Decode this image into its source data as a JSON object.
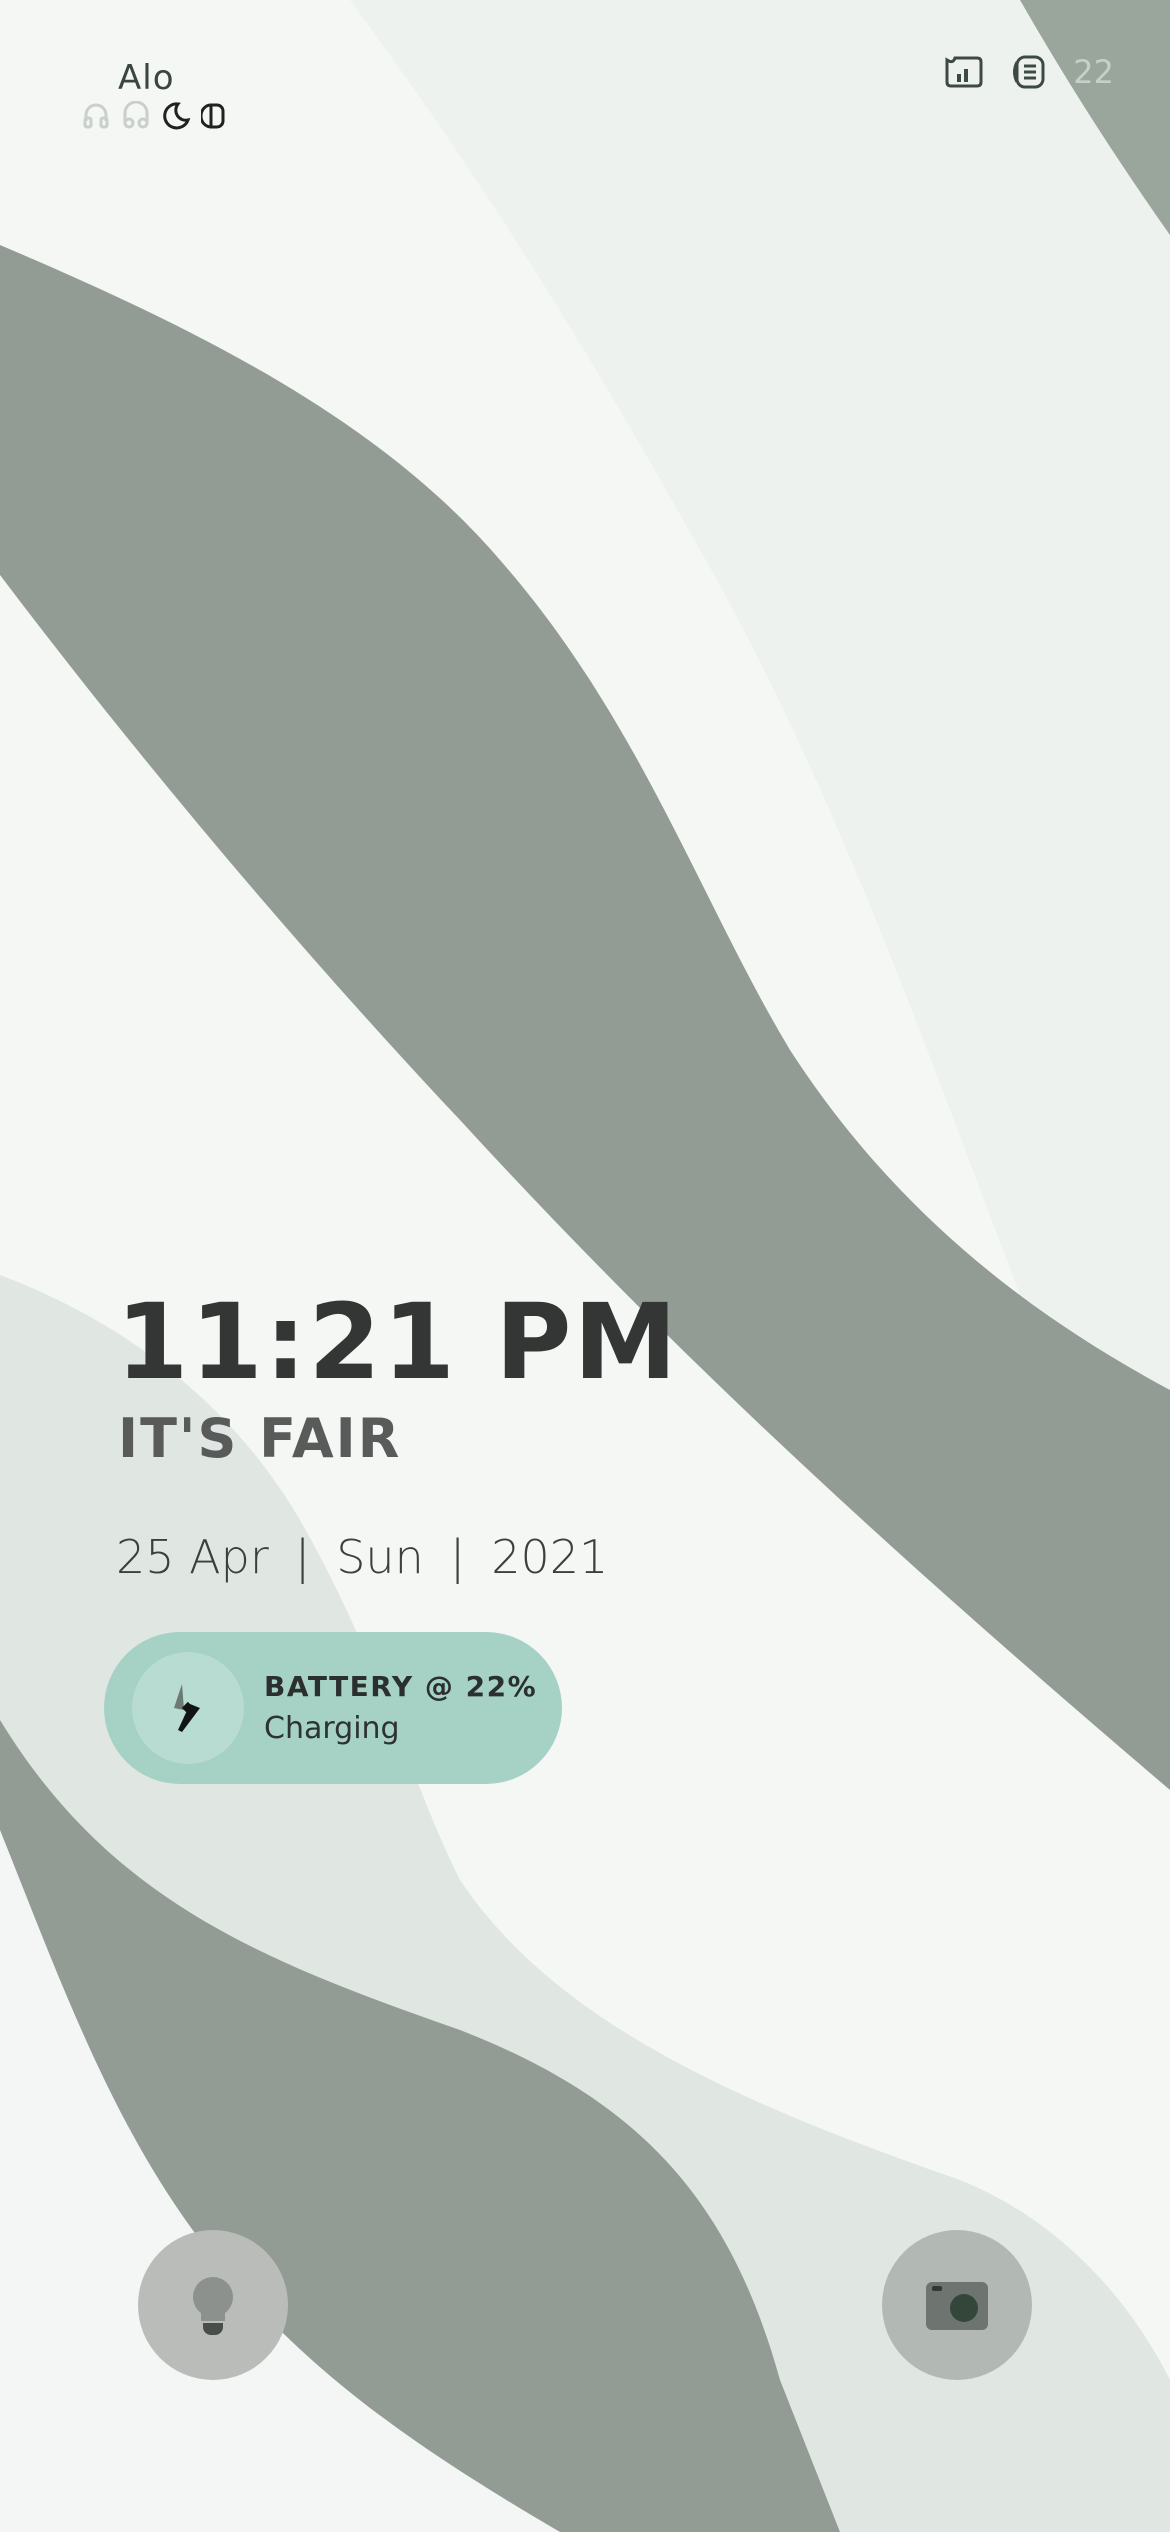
{
  "status_bar": {
    "carrier": "Alo",
    "battery_level_text": "22"
  },
  "lockscreen": {
    "time": "11:21 PM",
    "weather": "IT'S FAIR",
    "date": {
      "day_month": "25 Apr",
      "weekday": "Sun",
      "year": "2021",
      "separator": "|"
    },
    "battery_widget": {
      "title": "BATTERY @ 22%",
      "status": "Charging"
    }
  },
  "colors": {
    "wave_dark": "#939c94",
    "wave_light": "#e0e7e3",
    "battery_pill": "#a6d2c6",
    "text_dark": "#333635"
  }
}
